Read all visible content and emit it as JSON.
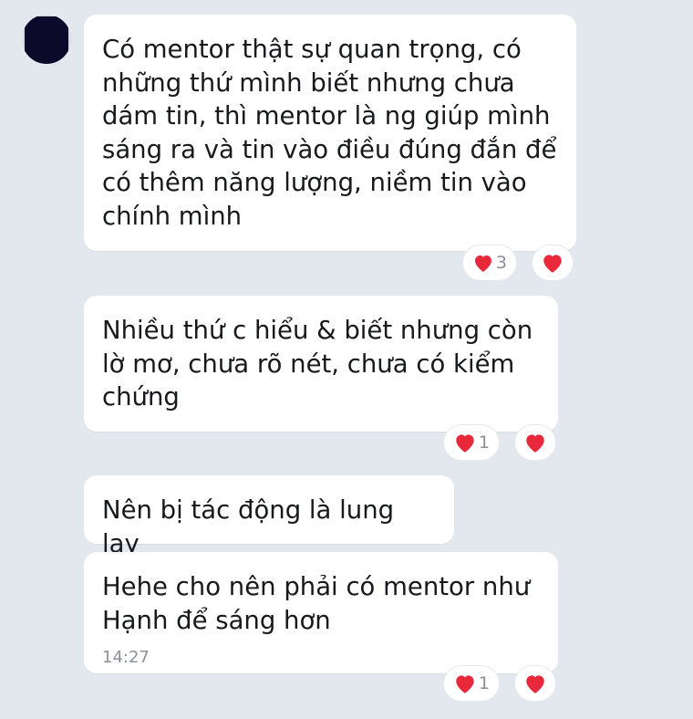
{
  "messages": [
    {
      "text": "Có mentor thật sự quan trọng, có những thứ mình biết nhưng chưa dám tin, thì mentor là ng giúp mình sáng ra và tin vào điều đúng đắn để có thêm năng lượng, niềm tin vào chính mình",
      "reaction_count": "3"
    },
    {
      "text": "Nhiều thứ c hiểu & biết nhưng còn lờ mơ, chưa rõ nét, chưa có kiểm chứng",
      "reaction_count": "1"
    },
    {
      "text": "Nên bị tác động là lung lay"
    },
    {
      "text": "Hehe cho nên phải có mentor như Hạnh để sáng hơn",
      "time": "14:27",
      "reaction_count": "1"
    }
  ],
  "colors": {
    "background": "#e3e7ee",
    "bubble": "#ffffff",
    "heart": "#e8283b",
    "time": "#8c929a"
  },
  "icons": {
    "reaction": "heart-icon"
  }
}
